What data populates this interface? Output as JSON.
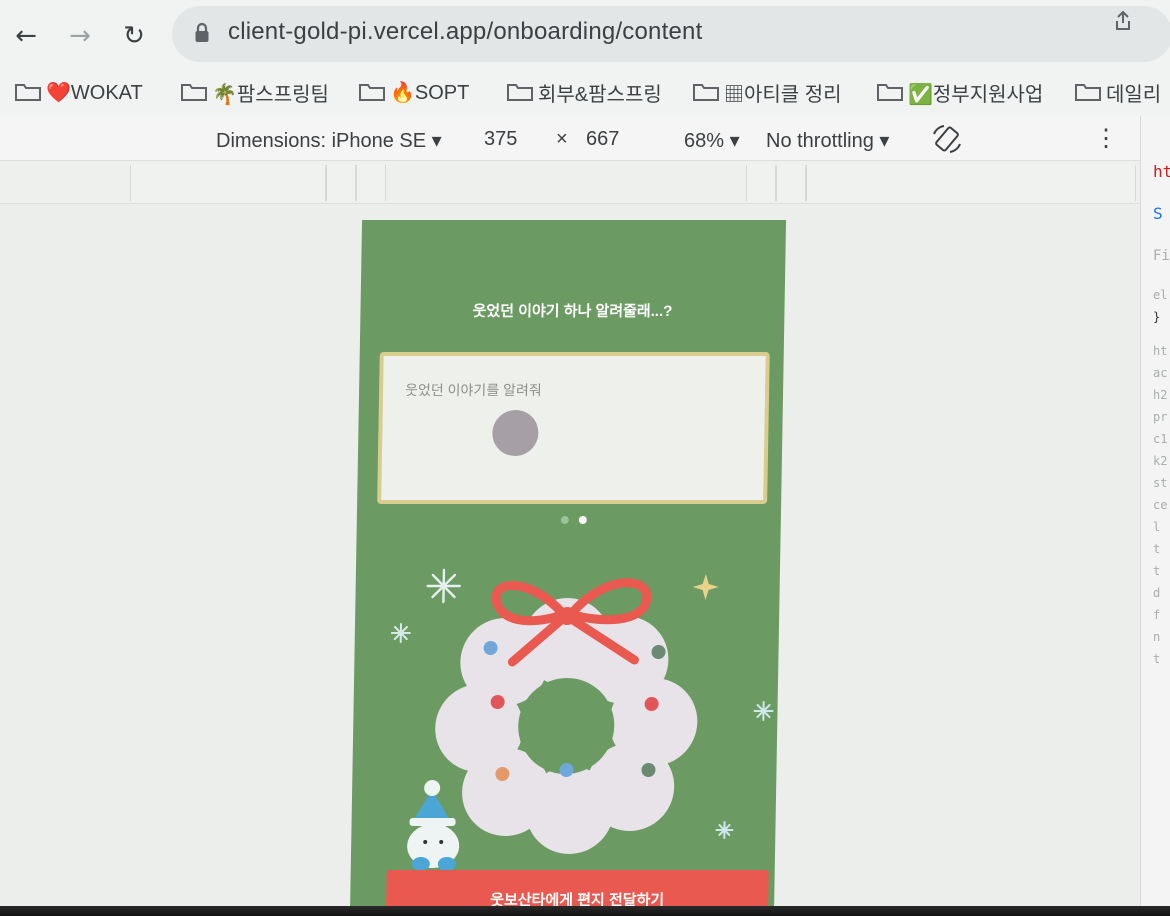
{
  "browser": {
    "url": "client-gold-pi.vercel.app/onboarding/content",
    "bookmarks": [
      {
        "label": "❤️WOKAT",
        "icon": "folder-icon"
      },
      {
        "label": "🌴팜스프링팀",
        "icon": "folder-icon"
      },
      {
        "label": "🔥SOPT",
        "icon": "folder-icon"
      },
      {
        "label": "회부&팜스프링",
        "icon": "folder-icon"
      },
      {
        "label": "▦아티클 정리",
        "icon": "folder-icon"
      },
      {
        "label": "✅정부지원사업",
        "icon": "folder-icon"
      },
      {
        "label": "데일리",
        "icon": "folder-icon"
      }
    ]
  },
  "device_toolbar": {
    "dimensions": "Dimensions: iPhone SE",
    "width": "375",
    "times": "×",
    "height": "667",
    "zoom": "68%",
    "throttling": "No throttling"
  },
  "devtools": {
    "lines": [
      "ht",
      "S",
      "Fi",
      "el",
      "}",
      "ht",
      "ac",
      "h2",
      "pr",
      "c1",
      "k2",
      "st",
      "ce",
      "l",
      "t",
      "t",
      "d",
      "f",
      "n",
      "t"
    ]
  },
  "app": {
    "question": "웃었던 이야기 하나 알려줄래...?",
    "input_placeholder": "웃었던 이야기를 알려줘",
    "pagination": {
      "count": 2,
      "active": 2
    },
    "cta_label": "웃보산타에게 편지 전달하기",
    "colors": {
      "background": "#6b9b62",
      "card": "#eef0ec",
      "card_border": "#d8cc8e",
      "cta": "#e9594f",
      "ribbon": "#e9594f",
      "wreath": "#e8e3e8"
    }
  }
}
